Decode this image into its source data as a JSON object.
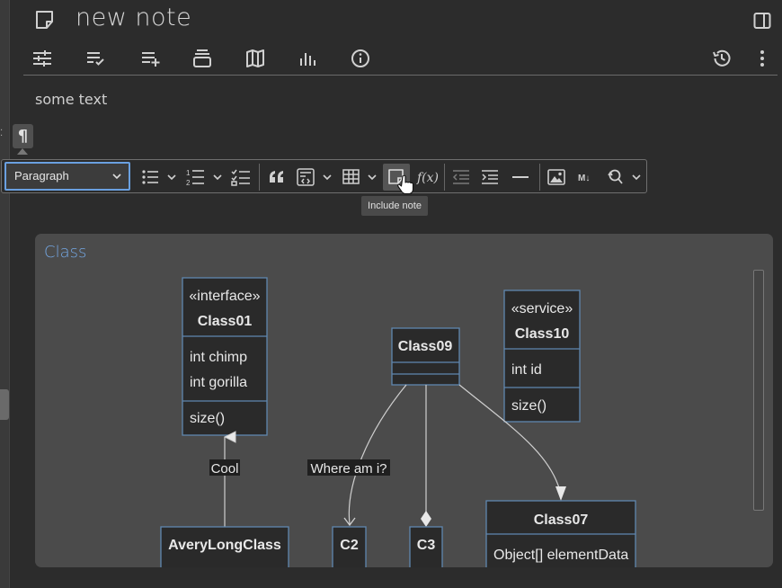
{
  "note": {
    "title": "new note"
  },
  "content": {
    "text": "some text"
  },
  "toolbar": {
    "heading": "Paragraph",
    "tooltip": "Include note"
  },
  "ribbon": {
    "icons": [
      "sliders-icon",
      "list-check-icon",
      "list-add-icon",
      "stack-icon",
      "map-icon",
      "chart-icon",
      "info-icon"
    ],
    "right_icons": [
      "history-icon",
      "more-icon"
    ]
  },
  "diagram": {
    "title": "Class",
    "classes": {
      "class01": {
        "stereotype": "«interface»",
        "name": "Class01",
        "attrs": [
          "int chimp",
          "int gorilla"
        ],
        "methods": [
          "size()"
        ]
      },
      "class09": {
        "name": "Class09"
      },
      "class10": {
        "stereotype": "«service»",
        "name": "Class10",
        "attrs": [
          "int id"
        ],
        "methods": [
          "size()"
        ]
      },
      "avery": {
        "name": "AveryLongClass"
      },
      "c2": {
        "name": "C2"
      },
      "c3": {
        "name": "C3"
      },
      "class07": {
        "name": "Class07",
        "attrs": [
          "Object[] elementData"
        ]
      }
    },
    "labels": {
      "cool": "Cool",
      "where": "Where am i?"
    }
  },
  "colors": {
    "accent": "#6aa0e0",
    "diagram_title": "#74a7e3",
    "uml_box": "#2a2a2a",
    "uml_border": "#5f87b0"
  }
}
